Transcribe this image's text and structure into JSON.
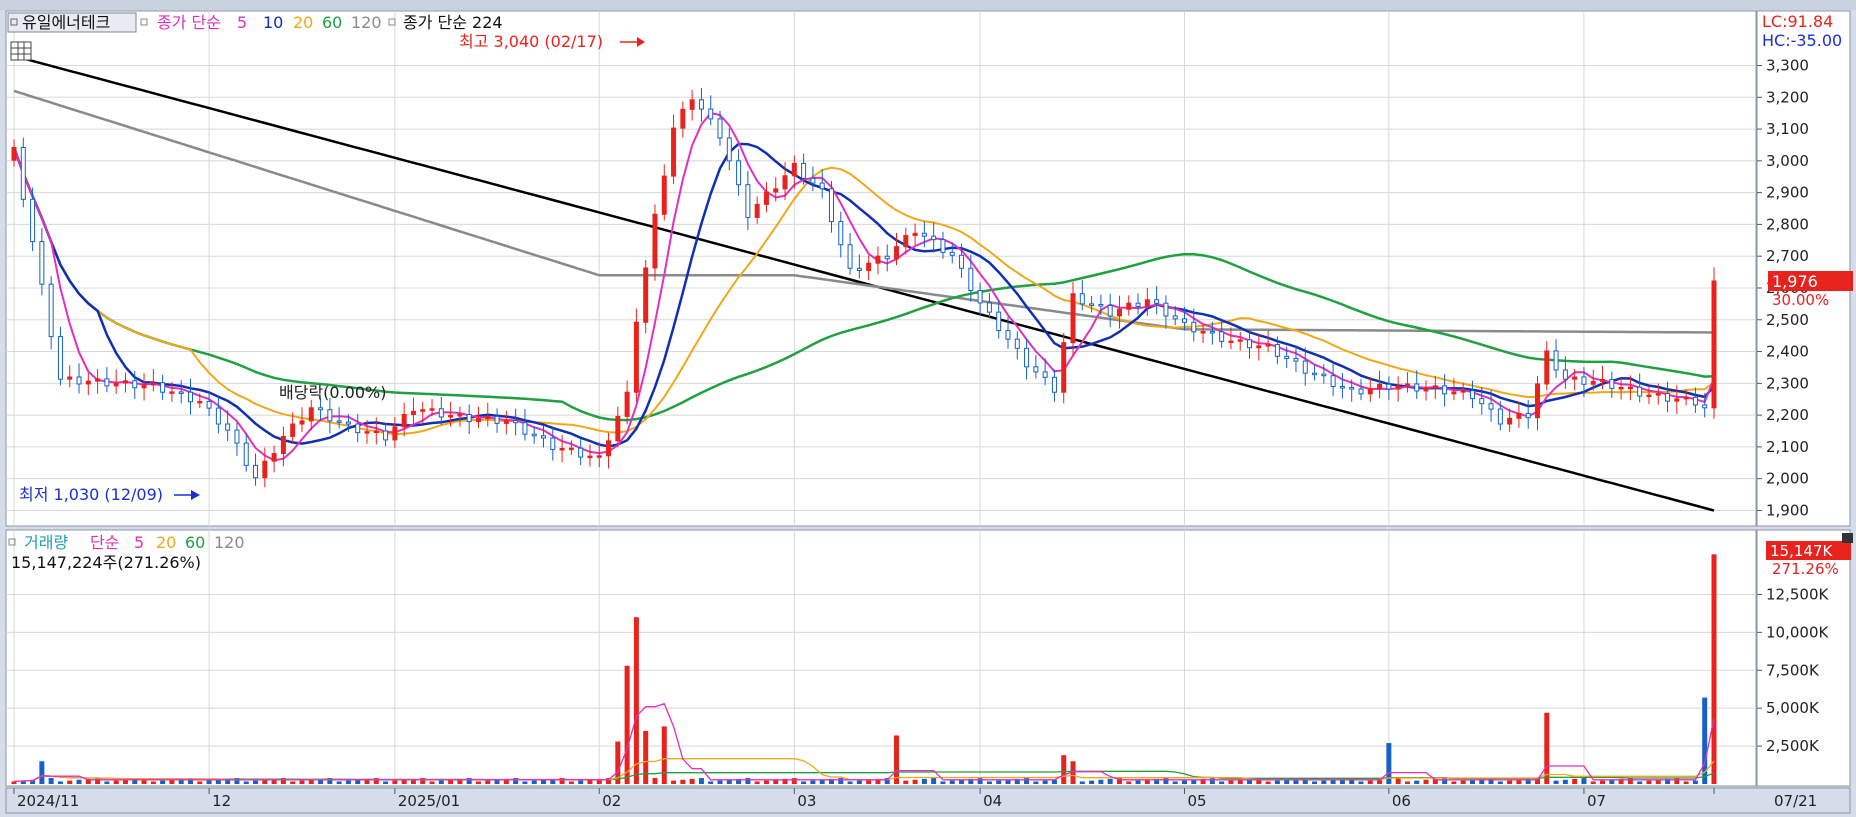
{
  "price_legend": {
    "stock_name": "유일에너테크",
    "ma_label": "종가 단순",
    "ma_periods": [
      "5",
      "10",
      "20",
      "60",
      "120"
    ],
    "ma224_label": "종가 단순 224"
  },
  "annotations": {
    "high_label": "최고 3,040 (02/17)",
    "low_label": "최저 1,030 (12/09)",
    "dividend_label": "배당락(0.00%)",
    "lc_label": "LC:91.84",
    "hc_label": "HC:-35.00",
    "last_price_label": "1,976",
    "last_change_label": "30.00%"
  },
  "volume_legend": {
    "title": "거래량",
    "ma_label": "단순",
    "ma_periods": [
      "5",
      "20",
      "60",
      "120"
    ],
    "last_volume_text": "15,147,224주(271.26%)",
    "last_volume_box": "15,147K",
    "last_volume_pct": "271.26%"
  },
  "colors": {
    "up": "#e8231e",
    "down": "#1660c8",
    "ma5": "#e030c0",
    "ma10": "#1030b0",
    "ma20": "#f0a818",
    "ma60": "#20a040",
    "ma120": "#8a8a8a",
    "ma224": "#000000",
    "grid": "#d8d8d8",
    "background": "#ffffff",
    "axis_bg": "#d4dde9"
  },
  "chart_data": {
    "type": "candlestick+volume",
    "price_axis": {
      "ticks": [
        "3,300",
        "3,200",
        "3,100",
        "3,000",
        "2,900",
        "2,800",
        "2,700",
        "2,600",
        "2,500",
        "2,400",
        "2,300",
        "2,200",
        "2,100",
        "2,000",
        "1,900"
      ],
      "ylim": [
        1870,
        3440
      ]
    },
    "volume_axis": {
      "ticks": [
        "12,500K",
        "10,000K",
        "7,500K",
        "5,000K",
        "2,500K"
      ],
      "ylim": [
        0,
        15300
      ]
    },
    "x_labels": [
      "2024/11",
      "12",
      "2025/01",
      "02",
      "03",
      "04",
      "05",
      "06",
      "07",
      "07/21"
    ],
    "dates": [
      "2024/11/01",
      "2024/11/04",
      "2024/11/05",
      "2024/11/06",
      "2024/11/07",
      "2024/11/08",
      "2024/11/11",
      "2024/11/12",
      "2024/11/13",
      "2024/11/14",
      "2024/11/15",
      "2024/11/18",
      "2024/11/19",
      "2024/11/20",
      "2024/11/21",
      "2024/11/22",
      "2024/11/25",
      "2024/11/26",
      "2024/11/27",
      "2024/11/28",
      "2024/11/29",
      "2024/12/02",
      "2024/12/03",
      "2024/12/04",
      "2024/12/05",
      "2024/12/06",
      "2024/12/09",
      "2024/12/10",
      "2024/12/11",
      "2024/12/12",
      "2024/12/13",
      "2024/12/16",
      "2024/12/17",
      "2024/12/18",
      "2024/12/19",
      "2024/12/20",
      "2024/12/23",
      "2024/12/24",
      "2024/12/26",
      "2024/12/27",
      "2024/12/30",
      "2025/01/02",
      "2025/01/03",
      "2025/01/06",
      "2025/01/07",
      "2025/01/08",
      "2025/01/09",
      "2025/01/10",
      "2025/01/13",
      "2025/01/14",
      "2025/01/15",
      "2025/01/16",
      "2025/01/17",
      "2025/01/20",
      "2025/01/21",
      "2025/01/22",
      "2025/01/23",
      "2025/01/24",
      "2025/01/27",
      "2025/01/28",
      "2025/01/29",
      "2025/01/30",
      "2025/01/31",
      "2025/02/03",
      "2025/02/04",
      "2025/02/05",
      "2025/02/06",
      "2025/02/07",
      "2025/02/10",
      "2025/02/11",
      "2025/02/12",
      "2025/02/13",
      "2025/02/14",
      "2025/02/17",
      "2025/02/18",
      "2025/02/19",
      "2025/02/20",
      "2025/02/21",
      "2025/02/24",
      "2025/02/25",
      "2025/02/26",
      "2025/02/27",
      "2025/02/28",
      "2025/03/03",
      "2025/03/04",
      "2025/03/05",
      "2025/03/06",
      "2025/03/07",
      "2025/03/10",
      "2025/03/11",
      "2025/03/12",
      "2025/03/13",
      "2025/03/14",
      "2025/03/17",
      "2025/03/18",
      "2025/03/19",
      "2025/03/20",
      "2025/03/21",
      "2025/03/24",
      "2025/03/25",
      "2025/03/26",
      "2025/03/27",
      "2025/03/28",
      "2025/03/31",
      "2025/04/01",
      "2025/04/02",
      "2025/04/03",
      "2025/04/04",
      "2025/04/07",
      "2025/04/08",
      "2025/04/09",
      "2025/04/10",
      "2025/04/11",
      "2025/04/14",
      "2025/04/15",
      "2025/04/16",
      "2025/04/17",
      "2025/04/18",
      "2025/04/21",
      "2025/04/22",
      "2025/04/23",
      "2025/04/24",
      "2025/04/25",
      "2025/04/28",
      "2025/04/29",
      "2025/04/30",
      "2025/05/01",
      "2025/05/02",
      "2025/05/05",
      "2025/05/06",
      "2025/05/07",
      "2025/05/08",
      "2025/05/09",
      "2025/05/12",
      "2025/05/13",
      "2025/05/14",
      "2025/05/15",
      "2025/05/16",
      "2025/05/19",
      "2025/05/20",
      "2025/05/21",
      "2025/05/22",
      "2025/05/23",
      "2025/05/26",
      "2025/05/27",
      "2025/05/28",
      "2025/05/29",
      "2025/05/30",
      "2025/06/02",
      "2025/06/03",
      "2025/06/04",
      "2025/06/05",
      "2025/06/06",
      "2025/06/09",
      "2025/06/10",
      "2025/06/11",
      "2025/06/12",
      "2025/06/13",
      "2025/06/16",
      "2025/06/17",
      "2025/06/18",
      "2025/06/19",
      "2025/06/20",
      "2025/06/23",
      "2025/06/24",
      "2025/06/25",
      "2025/06/26",
      "2025/06/27",
      "2025/06/30",
      "2025/07/01",
      "2025/07/02",
      "2025/07/03",
      "2025/07/04",
      "2025/07/07",
      "2025/07/08",
      "2025/07/09",
      "2025/07/10",
      "2025/07/11",
      "2025/07/14",
      "2025/07/15",
      "2025/07/16",
      "2025/07/17",
      "2025/07/18",
      "2025/07/21"
    ],
    "x_label_dates": [
      "2024/11/01",
      "2024/12/02",
      "2025/01/02",
      "2025/02/03",
      "2025/03/04",
      "2025/04/01",
      "2025/05/01",
      "2025/06/02",
      "2025/07/01",
      "2025/07/21"
    ],
    "close_anchors": [
      {
        "date": "2024/11/01",
        "close": 3030
      },
      {
        "date": "2024/11/06",
        "close": 2600
      },
      {
        "date": "2024/11/08",
        "close": 2310
      },
      {
        "date": "2024/11/22",
        "close": 2290
      },
      {
        "date": "2024/11/29",
        "close": 2240
      },
      {
        "date": "2024/12/04",
        "close": 2150
      },
      {
        "date": "2024/12/09",
        "close": 2000
      },
      {
        "date": "2024/12/12",
        "close": 2130
      },
      {
        "date": "2024/12/17",
        "close": 2220
      },
      {
        "date": "2024/12/23",
        "close": 2160
      },
      {
        "date": "2024/12/30",
        "close": 2130
      },
      {
        "date": "2025/01/06",
        "close": 2220
      },
      {
        "date": "2025/01/13",
        "close": 2190
      },
      {
        "date": "2025/01/20",
        "close": 2180
      },
      {
        "date": "2025/01/27",
        "close": 2100
      },
      {
        "date": "2025/02/03",
        "close": 2060
      },
      {
        "date": "2025/02/06",
        "close": 2260
      },
      {
        "date": "2025/02/07",
        "close": 2500
      },
      {
        "date": "2025/02/11",
        "close": 2820
      },
      {
        "date": "2025/02/13",
        "close": 3100
      },
      {
        "date": "2025/02/17",
        "close": 3200
      },
      {
        "date": "2025/02/20",
        "close": 3080
      },
      {
        "date": "2025/02/25",
        "close": 2830
      },
      {
        "date": "2025/03/04",
        "close": 2980
      },
      {
        "date": "2025/03/07",
        "close": 2900
      },
      {
        "date": "2025/03/12",
        "close": 2650
      },
      {
        "date": "2025/03/18",
        "close": 2700
      },
      {
        "date": "2025/03/21",
        "close": 2780
      },
      {
        "date": "2025/03/27",
        "close": 2700
      },
      {
        "date": "2025/04/01",
        "close": 2550
      },
      {
        "date": "2025/04/08",
        "close": 2360
      },
      {
        "date": "2025/04/11",
        "close": 2280
      },
      {
        "date": "2025/04/15",
        "close": 2570
      },
      {
        "date": "2025/04/21",
        "close": 2520
      },
      {
        "date": "2025/04/25",
        "close": 2560
      },
      {
        "date": "2025/05/01",
        "close": 2480
      },
      {
        "date": "2025/05/08",
        "close": 2430
      },
      {
        "date": "2025/05/14",
        "close": 2410
      },
      {
        "date": "2025/05/20",
        "close": 2340
      },
      {
        "date": "2025/05/27",
        "close": 2270
      },
      {
        "date": "2025/06/02",
        "close": 2290
      },
      {
        "date": "2025/06/09",
        "close": 2280
      },
      {
        "date": "2025/06/13",
        "close": 2260
      },
      {
        "date": "2025/06/18",
        "close": 2180
      },
      {
        "date": "2025/06/23",
        "close": 2200
      },
      {
        "date": "2025/06/25",
        "close": 2390
      },
      {
        "date": "2025/06/27",
        "close": 2310
      },
      {
        "date": "2025/07/03",
        "close": 2300
      },
      {
        "date": "2025/07/10",
        "close": 2260
      },
      {
        "date": "2025/07/17",
        "close": 2240
      },
      {
        "date": "2025/07/18",
        "close": 2220
      },
      {
        "date": "2025/07/21",
        "close": 2610
      }
    ],
    "ma224_anchors": [
      {
        "date": "2024/11/01",
        "value": 3330
      },
      {
        "date": "2025/07/21",
        "value": 1900
      }
    ],
    "ma120_anchors": [
      {
        "date": "2024/11/01",
        "value": 3220
      },
      {
        "date": "2025/02/03",
        "value": 2640
      },
      {
        "date": "2025/03/04",
        "value": 2640
      },
      {
        "date": "2025/05/01",
        "value": 2470
      },
      {
        "date": "2025/07/21",
        "value": 2460
      }
    ],
    "big_volume_bars": [
      {
        "date": "2024/11/06",
        "volume": 1500
      },
      {
        "date": "2025/02/05",
        "volume": 2800
      },
      {
        "date": "2025/02/06",
        "volume": 7800
      },
      {
        "date": "2025/02/07",
        "volume": 11000
      },
      {
        "date": "2025/02/10",
        "volume": 3500
      },
      {
        "date": "2025/02/12",
        "volume": 3800
      },
      {
        "date": "2025/03/19",
        "volume": 3200
      },
      {
        "date": "2025/04/14",
        "volume": 1900
      },
      {
        "date": "2025/04/15",
        "volume": 1500
      },
      {
        "date": "2025/06/02",
        "volume": 2700
      },
      {
        "date": "2025/06/25",
        "volume": 4700
      },
      {
        "date": "2025/07/18",
        "volume": 5700
      },
      {
        "date": "2025/07/21",
        "volume": 15147
      }
    ],
    "base_volume": 280,
    "high": {
      "date": "2025/02/17",
      "price": 3040
    },
    "low": {
      "date": "2024/12/09",
      "price": 1030
    }
  }
}
